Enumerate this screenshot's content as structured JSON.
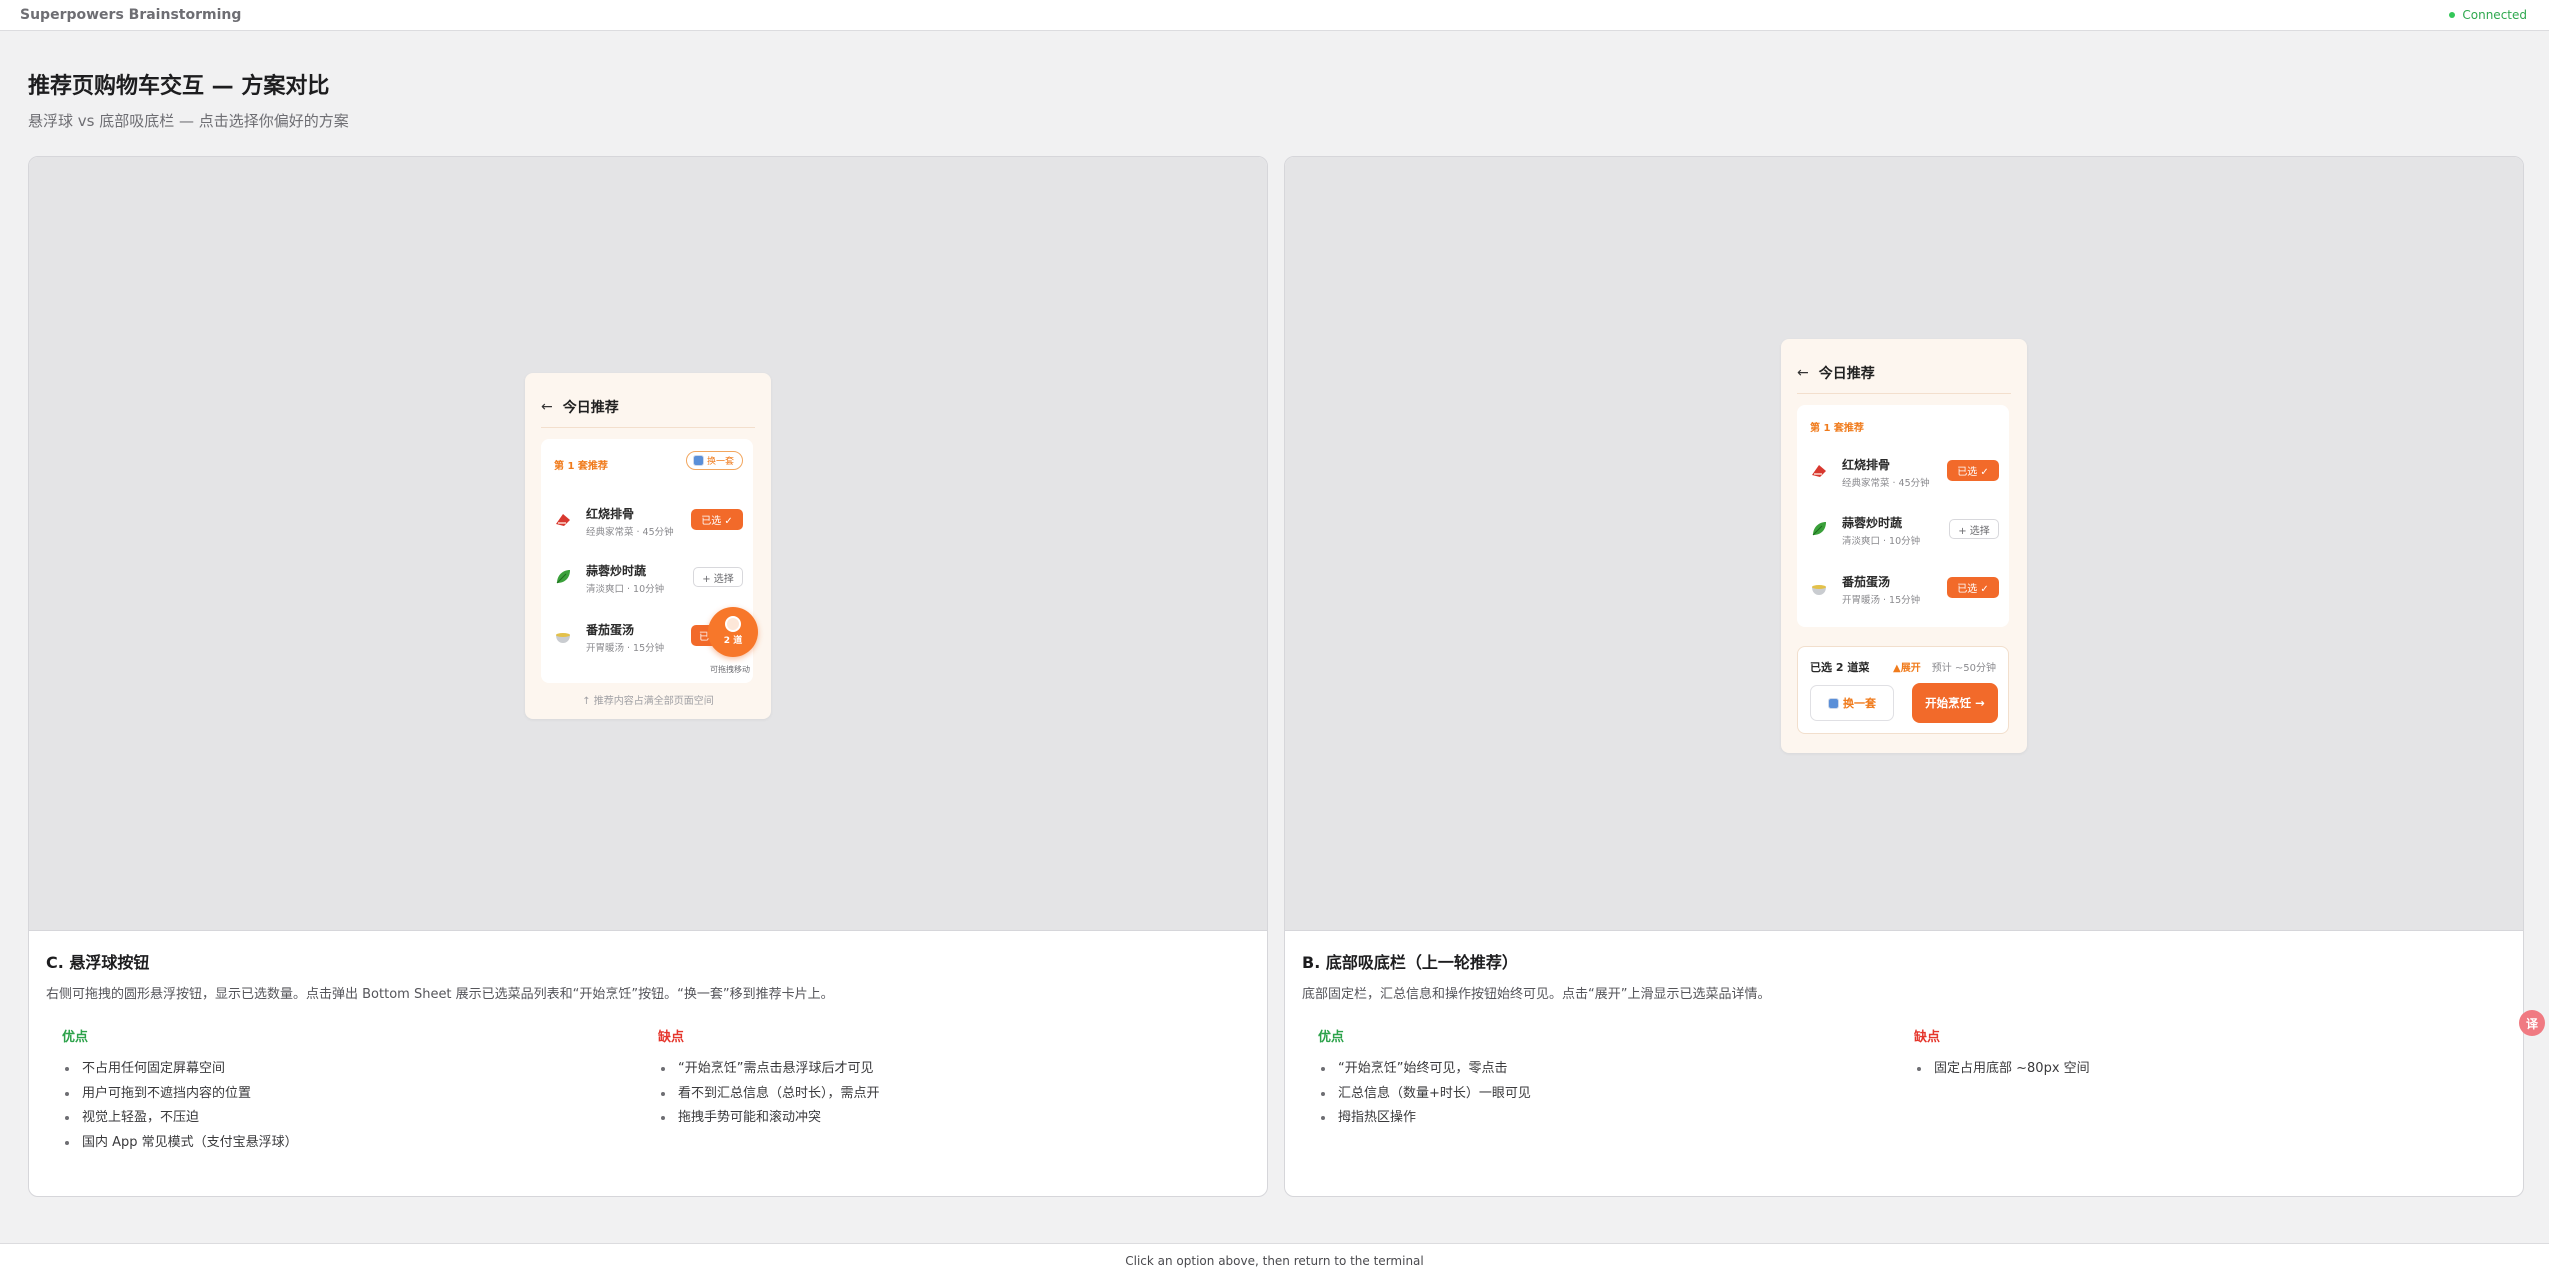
{
  "topbar": {
    "app_title": "Superpowers Brainstorming",
    "status": "Connected",
    "status_color": "#34c759"
  },
  "header": {
    "title": "推荐页购物车交互 — 方案对比",
    "subtitle": "悬浮球 vs 底部吸底栏 — 点击选择你偏好的方案"
  },
  "options": [
    {
      "title": "C. 悬浮球按钮",
      "description": "右侧可拖拽的圆形悬浮按钮，显示已选数量。点击弹出 Bottom Sheet 展示已选菜品列表和“开始烹饪”按钮。“换一套”移到推荐卡片上。",
      "pros_label": "优点",
      "pros": [
        "不占用任何固定屏幕空间",
        "用户可拖到不遮挡内容的位置",
        "视觉上轻盈，不压迫",
        "国内 App 常见模式（支付宝悬浮球）"
      ],
      "cons_label": "缺点",
      "cons": [
        "“开始烹饪”需点击悬浮球后才可见",
        "看不到汇总信息（总时长），需点开",
        "拖拽手势可能和滚动冲突"
      ],
      "mock": {
        "back": "←",
        "title": "今日推荐",
        "set_label": "第 1 套推荐",
        "swap_label": "换一套",
        "dishes": [
          {
            "name": "红烧排骨",
            "meta": "经典家常菜 · 45分钟",
            "state": "已选 ✓",
            "icon": "ribs-icon"
          },
          {
            "name": "蒜蓉炒时蔬",
            "meta": "清淡爽口 · 10分钟",
            "state": "+ 选择",
            "icon": "greens-icon"
          },
          {
            "name": "番茄蛋汤",
            "meta": "开胃暖汤 · 15分钟",
            "state": "已",
            "icon": "soup-icon"
          }
        ],
        "fab_count": "2 道",
        "drag_hint": "可拖拽移动",
        "footer_hint": "↑ 推荐内容占满全部页面空间"
      }
    },
    {
      "title": "B. 底部吸底栏（上一轮推荐）",
      "description": "底部固定栏，汇总信息和操作按钮始终可见。点击“展开”上滑显示已选菜品详情。",
      "pros_label": "优点",
      "pros": [
        "“开始烹饪”始终可见，零点击",
        "汇总信息（数量+时长）一眼可见",
        "拇指热区操作"
      ],
      "cons_label": "缺点",
      "cons": [
        "固定占用底部 ~80px 空间"
      ],
      "mock": {
        "back": "←",
        "title": "今日推荐",
        "set_label": "第 1 套推荐",
        "dishes": [
          {
            "name": "红烧排骨",
            "meta": "经典家常菜 · 45分钟",
            "state": "已选 ✓",
            "icon": "ribs-icon"
          },
          {
            "name": "蒜蓉炒时蔬",
            "meta": "清淡爽口 · 10分钟",
            "state": "+ 选择",
            "icon": "greens-icon"
          },
          {
            "name": "番茄蛋汤",
            "meta": "开胃暖汤 · 15分钟",
            "state": "已选 ✓",
            "icon": "soup-icon"
          }
        ],
        "bar_selected": "已选 2 道菜",
        "bar_expand": "▲展开",
        "bar_estimate": "预计 ~50分钟",
        "bar_swap": "换一套",
        "bar_start": "开始烹饪 →"
      }
    }
  ],
  "bottom_hint": "Click an option above, then return to the terminal",
  "colors": {
    "accent": "#f26a2a",
    "pros": "#2ca24a",
    "cons": "#e5352b"
  }
}
